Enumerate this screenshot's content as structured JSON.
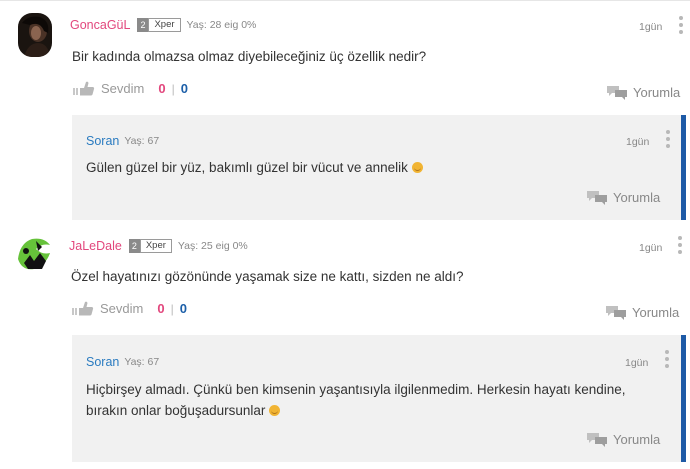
{
  "comments": [
    {
      "username": "GoncaGüL",
      "level": "2",
      "badge": "Xper",
      "age": "Yaş: 28 eig 0%",
      "time": "1gün",
      "text": "Bir kadında olmazsa olmaz diyebileceğiniz üç özellik nedir?",
      "like_label": "Sevdim",
      "likes": "0",
      "dislikes": "0",
      "reply_label": "Yorumla",
      "reply": {
        "username": "Soran",
        "age": "Yaş: 67",
        "time": "1gün",
        "text": "Gülen güzel bir yüz, bakımlı güzel bir vücut ve annelik",
        "reply_label": "Yorumla"
      }
    },
    {
      "username": "JaLeDale",
      "level": "2",
      "badge": "Xper",
      "age": "Yaş: 25 eig 0%",
      "time": "1gün",
      "text": "Özel hayatınızı gözönünde yaşamak size ne kattı, sizden ne aldı?",
      "like_label": "Sevdim",
      "likes": "0",
      "dislikes": "0",
      "reply_label": "Yorumla",
      "reply": {
        "username": "Soran",
        "age": "Yaş: 67",
        "time": "1gün",
        "text_line1": "Hiçbirşey almadı. Çünkü ben kimsenin yaşantısıyla ilgilenmedim. Herkesin hayatı kendine,",
        "text_line2": "bırakın onlar boğuşadursunlar",
        "reply_label": "Yorumla"
      }
    }
  ],
  "separator": "|",
  "icons": {
    "like": "thumbs-up-icon",
    "reply": "speech-bubbles-icon",
    "menu": "more-vertical-icon",
    "emoji": "smile-emoji-icon"
  },
  "colors": {
    "username_pink": "#e2477d",
    "username_blue": "#2a7bc0",
    "reply_accent": "#1d5aa6",
    "reply_bg": "#f1f1f1"
  }
}
